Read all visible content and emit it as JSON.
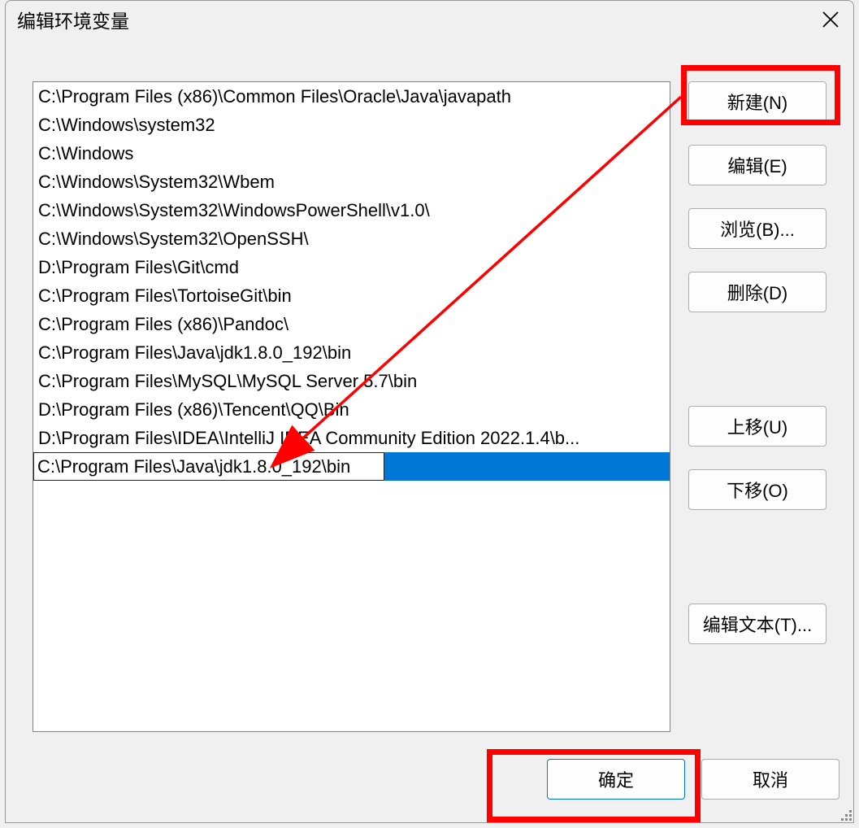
{
  "window": {
    "title": "编辑环境变量"
  },
  "list": {
    "items": [
      "C:\\Program Files (x86)\\Common Files\\Oracle\\Java\\javapath",
      "C:\\Windows\\system32",
      "C:\\Windows",
      "C:\\Windows\\System32\\Wbem",
      "C:\\Windows\\System32\\WindowsPowerShell\\v1.0\\",
      "C:\\Windows\\System32\\OpenSSH\\",
      "D:\\Program Files\\Git\\cmd",
      "C:\\Program Files\\TortoiseGit\\bin",
      "C:\\Program Files (x86)\\Pandoc\\",
      "C:\\Program Files\\Java\\jdk1.8.0_192\\bin",
      "C:\\Program Files\\MySQL\\MySQL Server 5.7\\bin",
      "D:\\Program Files (x86)\\Tencent\\QQ\\Bin",
      "D:\\Program Files\\IDEA\\IntelliJ IDEA Community Edition 2022.1.4\\b..."
    ],
    "editing_index": 13,
    "editing_value": "C:\\Program Files\\Java\\jdk1.8.0_192\\bin"
  },
  "buttons": {
    "new": "新建(N)",
    "edit": "编辑(E)",
    "browse": "浏览(B)...",
    "delete": "删除(D)",
    "moveup": "上移(U)",
    "movedown": "下移(O)",
    "edittext": "编辑文本(T)...",
    "ok": "确定",
    "cancel": "取消"
  },
  "annotation": {
    "highlight_color": "#ff0000"
  }
}
